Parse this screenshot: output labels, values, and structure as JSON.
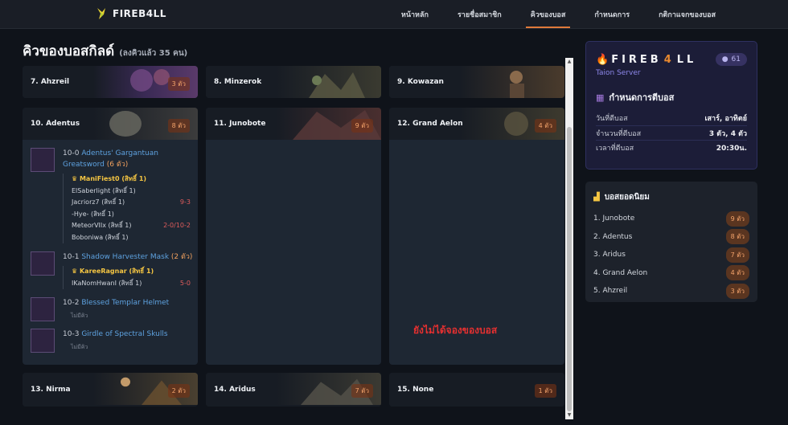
{
  "brand": {
    "name": "FIREB4LL"
  },
  "nav": [
    "หน้าหลัก",
    "รายชื่อสมาชิก",
    "คิวของบอส",
    "กำหนดการ",
    "กติกาแจกของบอส"
  ],
  "nav_active": 2,
  "page": {
    "title": "คิวของบอสกิลด์",
    "subtitle": "(ลงคิวแล้ว 35 คน)"
  },
  "bosses": {
    "b7": {
      "name": "7. Ahzreil",
      "count": "3 ตัว"
    },
    "b8": {
      "name": "8. Minzerok",
      "count": ""
    },
    "b9": {
      "name": "9. Kowazan",
      "count": ""
    },
    "b10": {
      "name": "10. Adentus",
      "count": "8 ตัว"
    },
    "b11": {
      "name": "11. Junobote",
      "count": "9 ตัว"
    },
    "b12": {
      "name": "12. Grand Aelon",
      "count": "4 ตัว"
    },
    "b13": {
      "name": "13. Nirma",
      "count": "2 ตัว"
    },
    "b14": {
      "name": "14. Aridus",
      "count": "7 ตัว"
    },
    "b15": {
      "name": "15. None",
      "count": "1 ตัว"
    }
  },
  "adentus_items": {
    "i0": {
      "code": "10-0",
      "name": "Adentus' Gargantuan Greatsword",
      "qty": "(6 ตัว)",
      "queue": [
        {
          "name": "ManiFiest0 (สิทธิ์ 1)",
          "score": ""
        },
        {
          "name": "ElSaberlight (สิทธิ์ 1)",
          "score": ""
        },
        {
          "name": "Jacriorz7 (สิทธิ์ 1)",
          "score": "9-3"
        },
        {
          "name": "-Hye- (สิทธิ์ 1)",
          "score": ""
        },
        {
          "name": "MeteorVIIx (สิทธิ์ 1)",
          "score": "2-0/10-2"
        },
        {
          "name": "Boboniwa (สิทธิ์ 1)",
          "score": ""
        }
      ]
    },
    "i1": {
      "code": "10-1",
      "name": "Shadow Harvester Mask",
      "qty": "(2 ตัว)",
      "queue": [
        {
          "name": "KareeRagnar (สิทธิ์ 1)",
          "score": ""
        },
        {
          "name": "IKaNomHwanI (สิทธิ์ 1)",
          "score": "5-0"
        }
      ]
    },
    "i2": {
      "code": "10-2",
      "name": "Blessed Templar Helmet",
      "qty": "",
      "empty": "ไม่มีคิว"
    },
    "i3": {
      "code": "10-3",
      "name": "Girdle of Spectral Skulls",
      "qty": "",
      "empty": "ไม่มีคิว"
    }
  },
  "overlay_note": "ยังไม่ได้จองของบอส",
  "server": {
    "name_pre": "FIREB",
    "name_hl": "4",
    "name_post": "LL",
    "members": "61",
    "label": "Taion Server",
    "schedule_title": "กำหนดการตีบอส",
    "rows": [
      {
        "k": "วันที่ตีบอส",
        "v": "เสาร์, อาทิตย์"
      },
      {
        "k": "จำนวนที่ตีบอส",
        "v": "3 ตัว, 4 ตัว"
      },
      {
        "k": "เวลาที่ตีบอส",
        "v": "20:30น."
      }
    ]
  },
  "popular": {
    "title": "บอสยอดนิยม",
    "rows": [
      {
        "name": "1. Junobote",
        "count": "9 ตัว"
      },
      {
        "name": "2. Adentus",
        "count": "8 ตัว"
      },
      {
        "name": "3. Aridus",
        "count": "7 ตัว"
      },
      {
        "name": "4. Grand Aelon",
        "count": "4 ตัว"
      },
      {
        "name": "5. Ahzreil",
        "count": "3 ตัว"
      }
    ]
  },
  "colors": {
    "accent": "#e07a3a",
    "link": "#5ea2e0",
    "leader": "#f4c542",
    "score": "#e05c5c"
  }
}
